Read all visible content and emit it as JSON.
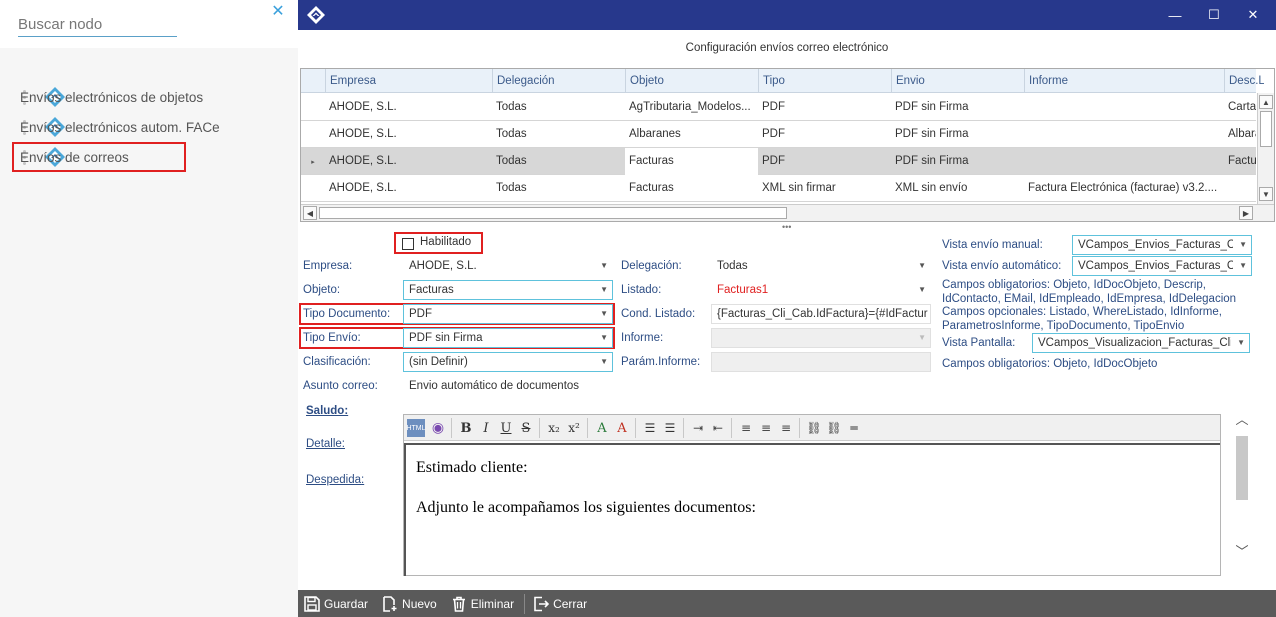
{
  "search": {
    "placeholder": "Buscar nodo"
  },
  "nav": {
    "items": [
      {
        "label": "Envíos electrónicos de objetos"
      },
      {
        "label": "Envíos electrónicos autom. FACe"
      },
      {
        "label": "Envíos de correos"
      }
    ]
  },
  "window": {
    "caption": "Configuración envíos correo electrónico"
  },
  "grid": {
    "columns": [
      "Empresa",
      "Delegación",
      "Objeto",
      "Tipo",
      "Envio",
      "Informe",
      "Desc.List"
    ],
    "rows": [
      [
        "AHODE, S.L.",
        "Todas",
        "AgTributaria_Modelos...",
        "PDF",
        "PDF sin Firma",
        "",
        "Carta"
      ],
      [
        "AHODE, S.L.",
        "Todas",
        "Albaranes",
        "PDF",
        "PDF sin Firma",
        "",
        "Albara"
      ],
      [
        "AHODE, S.L.",
        "Todas",
        "Facturas",
        "PDF",
        "PDF sin Firma",
        "",
        "Factur"
      ],
      [
        "AHODE, S.L.",
        "Todas",
        "Facturas",
        "XML sin firmar",
        "XML sin envío",
        "Factura Electrónica (facturae) v3.2....",
        ""
      ]
    ],
    "current_row_marker": "▸"
  },
  "form": {
    "habilitado_label": "Habilitado",
    "empresa_label": "Empresa:",
    "empresa_value": "AHODE, S.L.",
    "objeto_label": "Objeto:",
    "objeto_value": "Facturas",
    "tipo_documento_label": "Tipo Documento:",
    "tipo_documento_value": "PDF",
    "tipo_envio_label": "Tipo Envío:",
    "tipo_envio_value": "PDF sin Firma",
    "clasificacion_label": "Clasificación:",
    "clasificacion_value": "(sin Definir)",
    "asunto_label": "Asunto correo:",
    "asunto_value": "Envio automático de documentos",
    "delegacion_label": "Delegación:",
    "delegacion_value": "Todas",
    "listado_label": "Listado:",
    "listado_value": "Facturas1",
    "cond_listado_label": "Cond. Listado:",
    "cond_listado_value": "{Facturas_Cli_Cab.IdFactura}={#IdFactur",
    "informe_label": "Informe:",
    "informe_value": "",
    "param_informe_label": "Parám.Informe:",
    "param_informe_value": "",
    "vista_manual_label": "Vista envío manual:",
    "vista_manual_value": "VCampos_Envios_Facturas_C",
    "vista_automatico_label": "Vista envío automático:",
    "vista_automatico_value": "VCampos_Envios_Facturas_C",
    "campos_obligatorios_1": "Campos obligatorios: Objeto, IdDocObjeto, Descrip, IdContacto, EMail, IdEmpleado, IdEmpresa, IdDelegacion",
    "campos_opcionales": "Campos opcionales: Listado, WhereListado, IdInforme, ParametrosInforme, TipoDocumento, TipoEnvio",
    "vista_pantalla_label": "Vista Pantalla:",
    "vista_pantalla_value": "VCampos_Visualizacion_Facturas_Cli",
    "campos_obligatorios_2": "Campos obligatorios: Objeto, IdDocObjeto"
  },
  "editor": {
    "tabs": {
      "saludo": "Saludo:",
      "detalle": "Detalle:",
      "despedida": "Despedida:"
    },
    "lines": [
      "Estimado cliente:",
      "Adjunto le acompañamos los siguientes documentos:"
    ]
  },
  "bottombar": {
    "guardar": "Guardar",
    "nuevo": "Nuevo",
    "eliminar": "Eliminar",
    "cerrar": "Cerrar"
  },
  "colors": {
    "titlebar": "#27388c",
    "accent_border": "#5ec2dc",
    "highlight_box": "#e02020",
    "bottombar": "#5a5a5a"
  }
}
